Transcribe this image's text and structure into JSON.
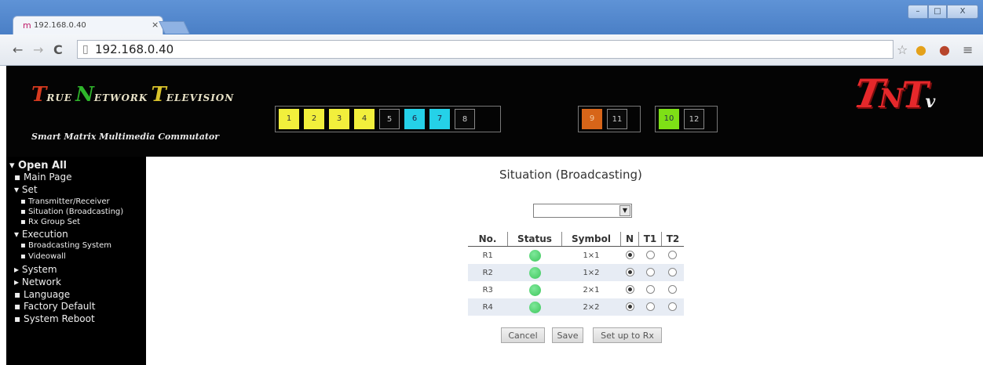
{
  "browser": {
    "tab_title": "192.168.0.40",
    "tab_close": "×",
    "url": "192.168.0.40",
    "window_buttons": [
      "–",
      "□",
      "X"
    ]
  },
  "header": {
    "logo_words": [
      {
        "initial": "T",
        "rest": "RUE"
      },
      {
        "initial": "N",
        "rest": "ETWORK"
      },
      {
        "initial": "T",
        "rest": "ELEVISION"
      }
    ],
    "subtitle": "Smart Matrix Multimedia Commutator",
    "channel_groups": [
      [
        {
          "label": "1",
          "color": "yellow"
        },
        {
          "label": "2",
          "color": "yellow"
        },
        {
          "label": "3",
          "color": "yellow"
        },
        {
          "label": "4",
          "color": "yellow"
        },
        {
          "label": "5",
          "color": "dark"
        },
        {
          "label": "6",
          "color": "cyan"
        },
        {
          "label": "7",
          "color": "cyan"
        },
        {
          "label": "8",
          "color": "dark"
        }
      ],
      [
        {
          "label": "9",
          "color": "orange"
        },
        {
          "label": "11",
          "color": "dark"
        }
      ],
      [
        {
          "label": "10",
          "color": "green"
        },
        {
          "label": "12",
          "color": "dark"
        }
      ]
    ],
    "brand_logo": "TNTv",
    "colors": {
      "yellow": "#f2ef3c",
      "cyan": "#25d1e8",
      "orange": "#d76519",
      "green": "#7ee016",
      "dark": "#0a0a0a"
    }
  },
  "sidebar": {
    "items": [
      {
        "label": "▾ Open All"
      },
      {
        "label": "▪ Main Page"
      },
      {
        "label": "▾ Set"
      },
      {
        "label": "▪ Transmitter/Receiver"
      },
      {
        "label": "▪ Situation (Broadcasting)"
      },
      {
        "label": "▪ Rx Group Set"
      },
      {
        "label": "▾ Execution"
      },
      {
        "label": "▪ Broadcasting System"
      },
      {
        "label": "▪ Videowall"
      },
      {
        "label": "▸ System"
      },
      {
        "label": "▸ Network"
      },
      {
        "label": "▪ Language"
      },
      {
        "label": "▪ Factory Default"
      },
      {
        "label": "▪ System Reboot"
      }
    ]
  },
  "main": {
    "title": "Situation (Broadcasting)",
    "select_value": "",
    "table": {
      "headers": [
        "No.",
        "Status",
        "Symbol",
        "N",
        "T1",
        "T2"
      ],
      "rows": [
        {
          "no": "R1",
          "symbol": "1×1",
          "selected": "N"
        },
        {
          "no": "R2",
          "symbol": "1×2",
          "selected": "N"
        },
        {
          "no": "R3",
          "symbol": "2×1",
          "selected": "N"
        },
        {
          "no": "R4",
          "symbol": "2×2",
          "selected": "N"
        }
      ]
    },
    "buttons": {
      "cancel": "Cancel",
      "save": "Save",
      "setup": "Set up to Rx"
    }
  }
}
